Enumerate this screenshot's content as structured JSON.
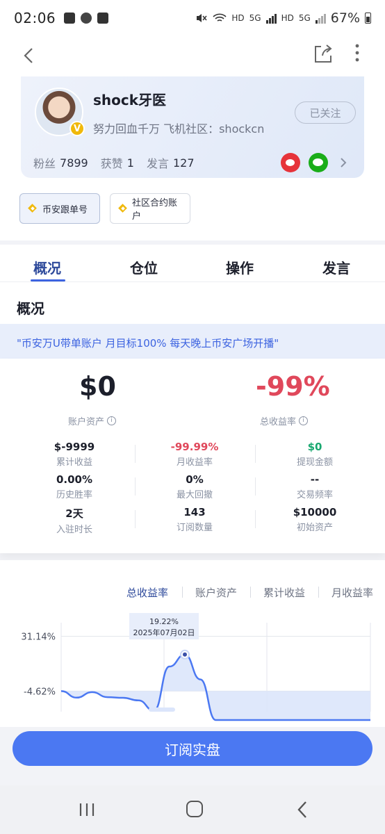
{
  "status_bar": {
    "time": "02:06",
    "network_1": "HD",
    "network_2": "5G",
    "network_3": "HD",
    "network_4": "5G",
    "battery": "67%"
  },
  "profile": {
    "name": "shock牙医",
    "bio": "努力回血千万 飞机社区：shockcn",
    "follow_label": "已关注",
    "fans_label": "粉丝",
    "fans_value": "7899",
    "likes_label": "获赞",
    "likes_value": "1",
    "posts_label": "发言",
    "posts_value": "127",
    "verified_badge": "V"
  },
  "account_tags": [
    {
      "label": "币安跟单号"
    },
    {
      "label": "社区合约账户"
    }
  ],
  "tabs": [
    {
      "label": "概况"
    },
    {
      "label": "仓位"
    },
    {
      "label": "操作"
    },
    {
      "label": "发言"
    }
  ],
  "overview": {
    "title": "概况",
    "notice": "\"币安万U带单账户 月目标100% 每天晚上币安广场开播\"",
    "asset_value": "$0",
    "asset_label": "账户资产",
    "total_rate_value": "-99%",
    "total_rate_label": "总收益率",
    "metrics": [
      {
        "value": "$-9999",
        "label": "累计收益"
      },
      {
        "value": "-99.99%",
        "label": "月收益率"
      },
      {
        "value": "$0",
        "label": "提现金额"
      },
      {
        "value": "0.00%",
        "label": "历史胜率"
      },
      {
        "value": "0%",
        "label": "最大回撤"
      },
      {
        "value": "--",
        "label": "交易频率"
      },
      {
        "value": "2天",
        "label": "入驻时长"
      },
      {
        "value": "143",
        "label": "订阅数量"
      },
      {
        "value": "$10000",
        "label": "初始资产"
      }
    ]
  },
  "chart_tabs": [
    {
      "label": "总收益率"
    },
    {
      "label": "账户资产"
    },
    {
      "label": "累计收益"
    },
    {
      "label": "月收益率"
    }
  ],
  "chart_data": {
    "type": "area",
    "title": "",
    "xlabel": "",
    "ylabel": "",
    "ytick_labels": [
      "31.14%",
      "-4.62%"
    ],
    "tooltip": {
      "value": "19.22%",
      "date": "2025年07月02日"
    },
    "ylim": [
      -50,
      40
    ],
    "series": [
      {
        "x": [
          0,
          1,
          2,
          3,
          4,
          5,
          6,
          7,
          8,
          9,
          10,
          11,
          12,
          13,
          14,
          15,
          16,
          17,
          18,
          19,
          20
        ],
        "values": [
          -4.6,
          -8.9,
          -5.3,
          -8.6,
          -9.0,
          -10.7,
          -17.4,
          11.4,
          19.22,
          3.0,
          -48,
          -52,
          -55,
          -57,
          -58,
          -59,
          -60,
          -61,
          -62,
          -63,
          -64
        ]
      }
    ],
    "colors": {
      "line": "#4b78f2",
      "fill": "#dbe5fb"
    }
  },
  "actions": {
    "subscribe_label": "订阅实盘"
  }
}
